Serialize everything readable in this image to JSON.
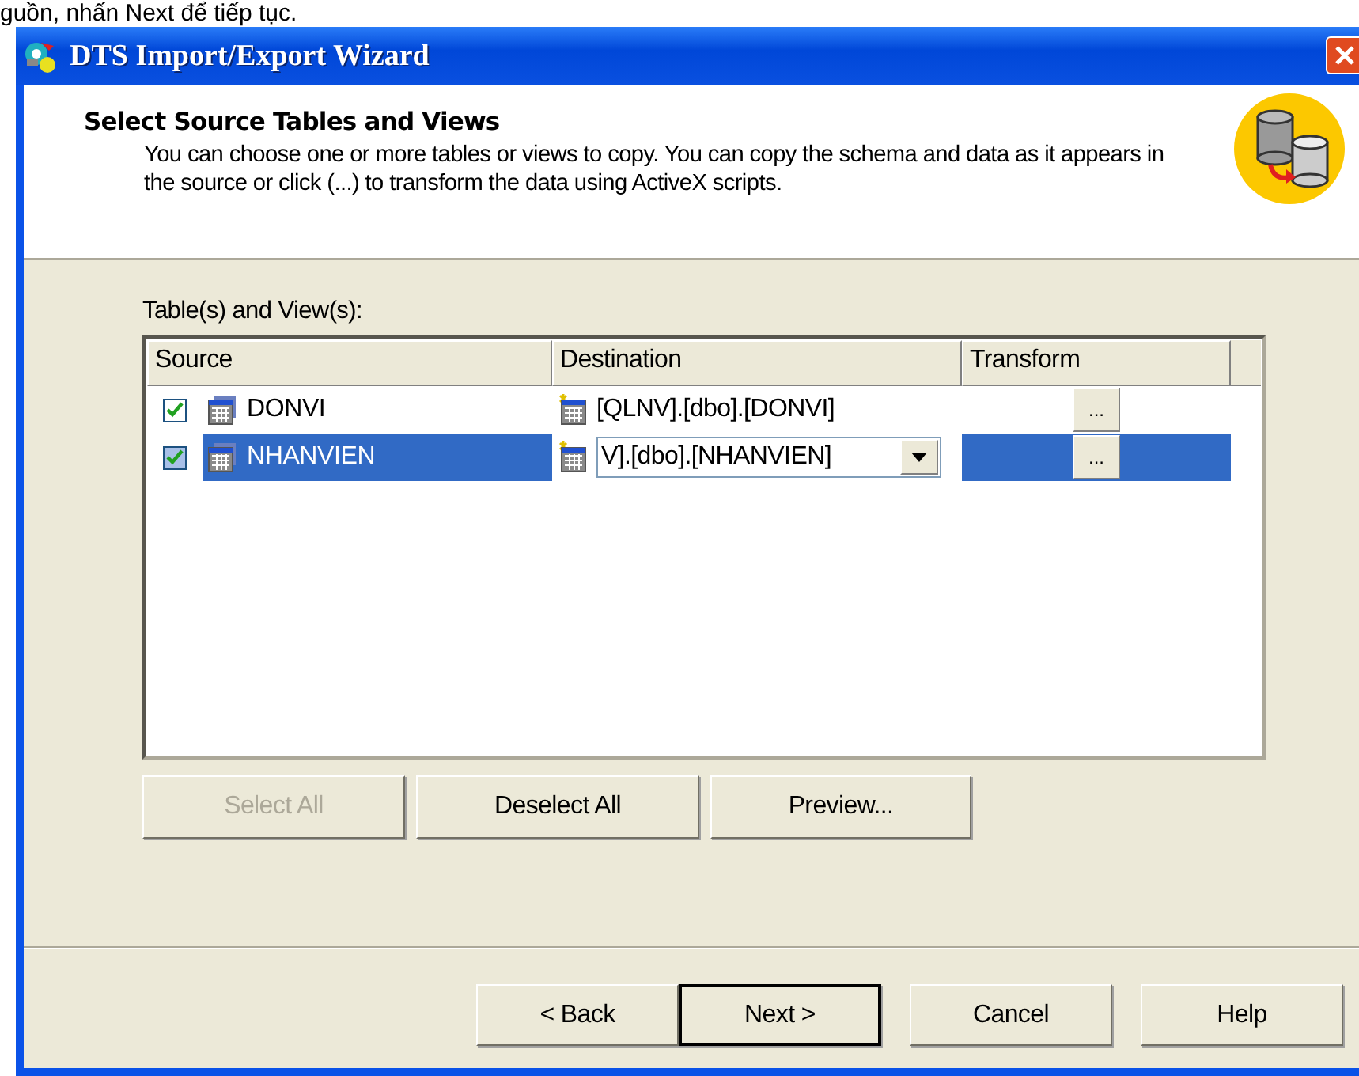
{
  "caption": "guồn, nhấn Next để tiếp tục.",
  "window": {
    "title": "DTS Import/Export Wizard"
  },
  "header": {
    "title": "Select Source Tables and Views",
    "description": "You can choose one or more tables or views to copy.  You can copy the schema and data as it appears in the source or click (...) to transform the data using ActiveX scripts."
  },
  "list_label": "Table(s) and View(s):",
  "table": {
    "columns": [
      "Source",
      "Destination",
      "Transform"
    ],
    "rows": [
      {
        "checked": true,
        "selected": false,
        "source": "DONVI",
        "destination": "[QLNV].[dbo].[DONVI]",
        "transform": "...",
        "editing": false
      },
      {
        "checked": true,
        "selected": true,
        "source": "NHANVIEN",
        "destination": "V].[dbo].[NHANVIEN]",
        "transform": "...",
        "editing": true
      }
    ]
  },
  "list_buttons": [
    {
      "label": "Select All",
      "disabled": true
    },
    {
      "label": "Deselect All",
      "disabled": false
    },
    {
      "label": "Preview...",
      "disabled": false
    }
  ],
  "footer_buttons": [
    {
      "label": "< Back",
      "default": false
    },
    {
      "label": "Next >",
      "default": true
    },
    {
      "label": "Cancel",
      "default": false
    },
    {
      "label": "Help",
      "default": false
    }
  ]
}
